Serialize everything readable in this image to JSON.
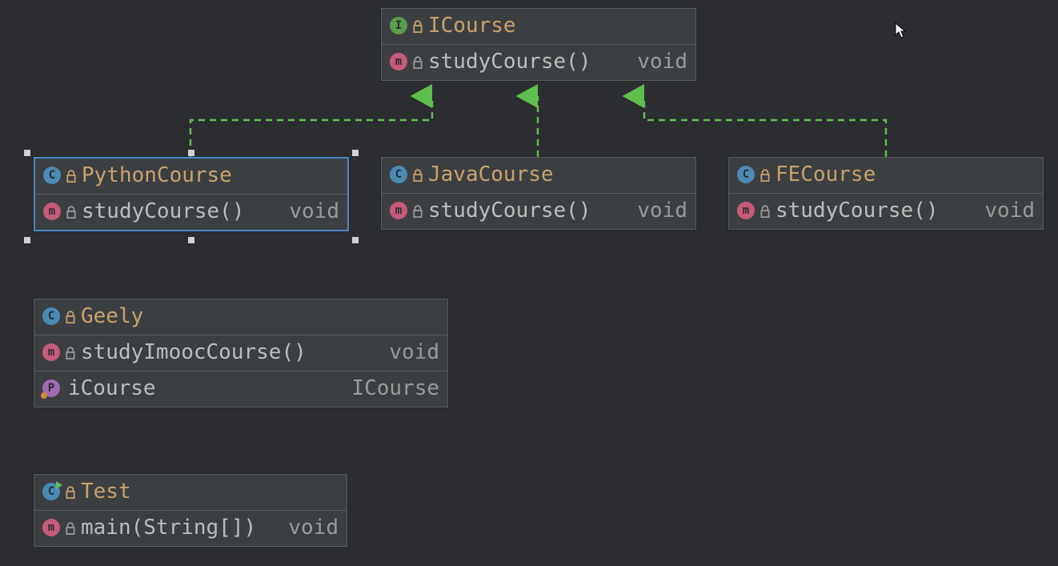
{
  "colors": {
    "arrow": "#5fbf4d",
    "selection": "#4a88c7"
  },
  "nodes": {
    "icourse": {
      "type": "interface",
      "name": "ICourse",
      "members": [
        {
          "kind": "method",
          "name": "studyCourse()",
          "returns": "void"
        }
      ]
    },
    "python": {
      "type": "class",
      "name": "PythonCourse",
      "selected": true,
      "members": [
        {
          "kind": "method",
          "name": "studyCourse()",
          "returns": "void"
        }
      ]
    },
    "java": {
      "type": "class",
      "name": "JavaCourse",
      "members": [
        {
          "kind": "method",
          "name": "studyCourse()",
          "returns": "void"
        }
      ]
    },
    "fe": {
      "type": "class",
      "name": "FECourse",
      "members": [
        {
          "kind": "method",
          "name": "studyCourse()",
          "returns": "void"
        }
      ]
    },
    "geely": {
      "type": "class",
      "name": "Geely",
      "members": [
        {
          "kind": "method",
          "name": "studyImoocCourse()",
          "returns": "void"
        },
        {
          "kind": "property",
          "name": "iCourse",
          "returns": "ICourse"
        }
      ]
    },
    "test": {
      "type": "runnable-class",
      "name": "Test",
      "members": [
        {
          "kind": "method",
          "name": "main(String[])",
          "returns": "void"
        }
      ]
    }
  }
}
